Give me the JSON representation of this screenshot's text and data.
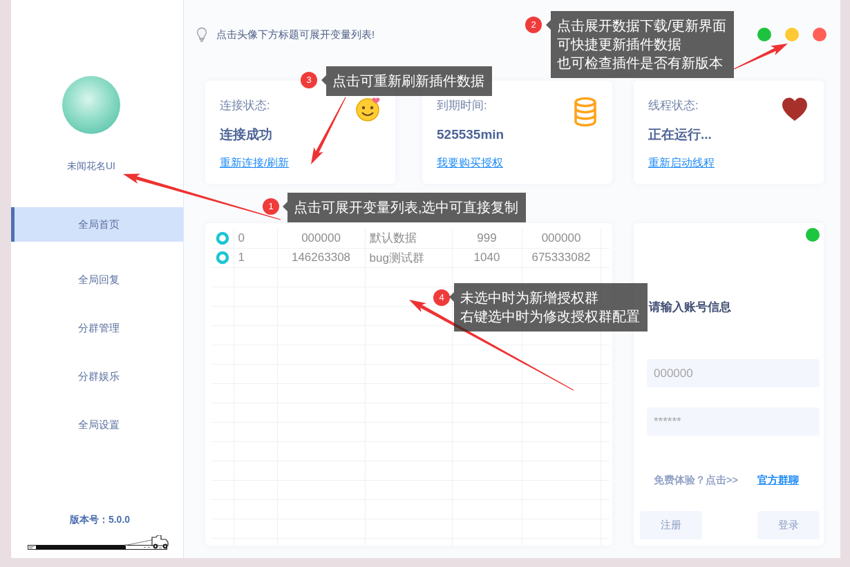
{
  "topbar": {
    "hint": "点击头像下方标题可展开变量列表!",
    "window_controls": [
      {
        "color": "#1dc33f"
      },
      {
        "color": "#ffc933"
      },
      {
        "color": "#ff5f57"
      }
    ]
  },
  "sidebar": {
    "username": "未闻花名UI",
    "items": [
      {
        "label": "全局首页",
        "selected": true
      },
      {
        "label": "全局回复",
        "selected": false
      },
      {
        "label": "分群管理",
        "selected": false
      },
      {
        "label": "分群娱乐",
        "selected": false
      },
      {
        "label": "全局设置",
        "selected": false
      }
    ],
    "version": "版本号：5.0.0"
  },
  "cards": [
    {
      "label": "连接状态:",
      "value": "连接成功",
      "link": "重新连接/刷新"
    },
    {
      "label": "到期时间:",
      "value": "525535min",
      "link": "我要购买授权"
    },
    {
      "label": "线程状态:",
      "value": "正在运行...",
      "link": "重新启动线程"
    }
  ],
  "table": {
    "rows": [
      [
        "0",
        "000000",
        "默认数据",
        "999",
        "000000"
      ],
      [
        "1",
        "146263308",
        "bug测试群",
        "1040",
        "675333082"
      ]
    ]
  },
  "login": {
    "connected": true,
    "title": "请输入账号信息",
    "account": {
      "placeholder": "000000"
    },
    "password": {
      "placeholder": "******"
    },
    "trial_text": "免费体验？点击>>",
    "group_link": "官方群聊",
    "buttons": [
      "注册",
      "登录"
    ]
  },
  "annotations": [
    {
      "number": "2",
      "lines": [
        "点击展开数据下载/更新界面",
        "可快捷更新插件数据",
        "也可检查插件是否有新版本"
      ]
    },
    {
      "number": "3",
      "lines": [
        "点击可重新刷新插件数据"
      ]
    },
    {
      "number": "1",
      "lines": [
        "点击可展开变量列表,选中可直接复制"
      ]
    },
    {
      "number": "4",
      "lines": [
        "未选中时为新增授权群",
        "右键选中时为修改授权群配置"
      ]
    }
  ]
}
